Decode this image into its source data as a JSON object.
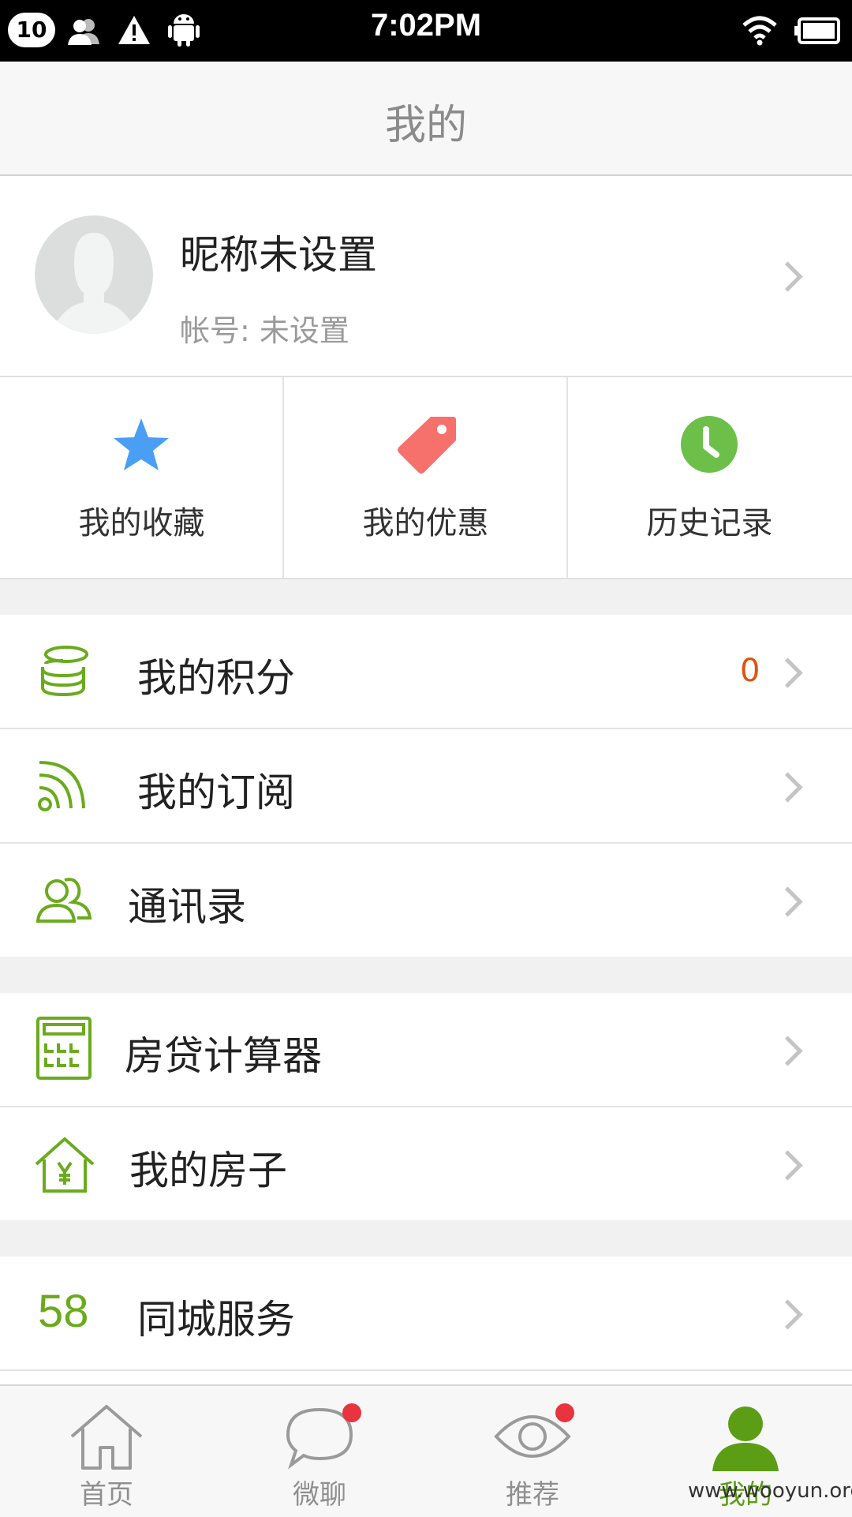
{
  "status_bar": {
    "notification_count": "10",
    "time": "7:02PM"
  },
  "header": {
    "title": "我的"
  },
  "profile": {
    "nickname": "昵称未设置",
    "account": "帐号:  未设置"
  },
  "shortcuts": [
    {
      "label": "我的收藏",
      "icon": "star-icon",
      "color": "#4a9ff5"
    },
    {
      "label": "我的优惠",
      "icon": "tag-icon",
      "color": "#f6706c"
    },
    {
      "label": "历史记录",
      "icon": "clock-icon",
      "color": "#6cc04a"
    }
  ],
  "menu": {
    "points": {
      "label": "我的积分",
      "value": "0",
      "icon": "coins-icon"
    },
    "subscription": {
      "label": "我的订阅",
      "icon": "rss-icon"
    },
    "contacts": {
      "label": "通讯录",
      "icon": "contacts-icon"
    },
    "mortgage": {
      "label": "房贷计算器",
      "icon": "calculator-icon"
    },
    "house": {
      "label": "我的房子",
      "icon": "house-yen-icon"
    },
    "city": {
      "label": "同城服务",
      "prefix": "58"
    }
  },
  "tabs": [
    {
      "label": "首页",
      "icon": "home-icon",
      "badge": false
    },
    {
      "label": "微聊",
      "icon": "chat-icon",
      "badge": true
    },
    {
      "label": "推荐",
      "icon": "eye-icon",
      "badge": true
    },
    {
      "label": "我的",
      "icon": "person-icon",
      "badge": false,
      "active": true
    }
  ],
  "watermark": "www.wooyun.org",
  "colors": {
    "accent": "#6aab1e",
    "value_orange": "#e0520f",
    "active_tab": "#5b9e16"
  }
}
